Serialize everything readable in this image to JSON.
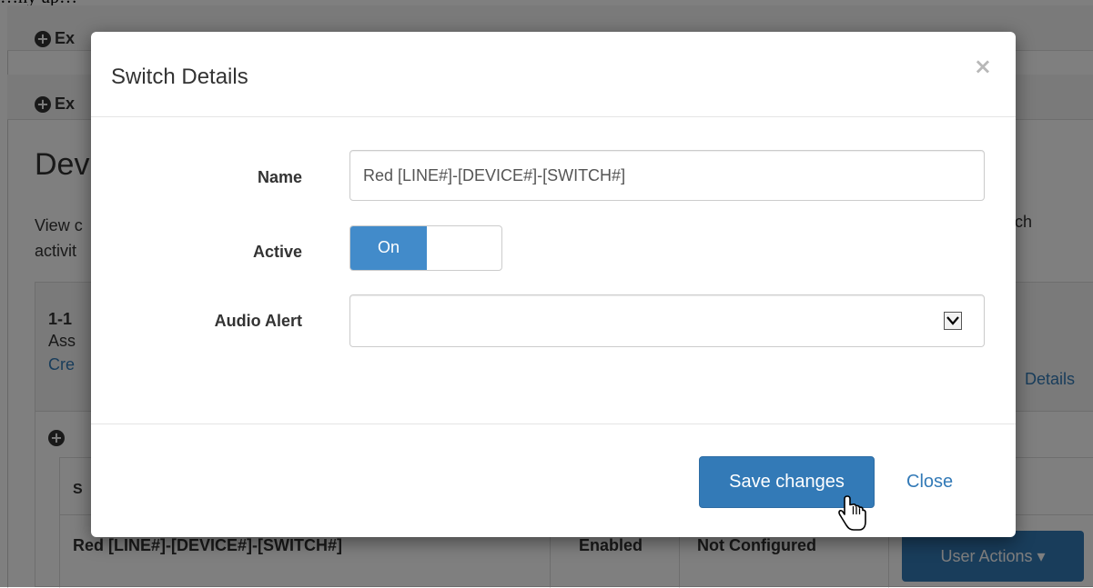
{
  "top_caption": "…hy up…",
  "background": {
    "expand_link_1": "Ex",
    "expand_link_2": "Ex",
    "title": "Dev",
    "desc_line1": "View c",
    "desc_line2": "activit",
    "desc_right": "tch",
    "card": {
      "id": "1-1",
      "subtitle": "Ass",
      "link": "Cre",
      "details_link": "Details",
      "table_header": "S",
      "row": {
        "name": "Red [LINE#]-[DEVICE#]-[SWITCH#]",
        "status": "Enabled",
        "audio": "Not Configured",
        "actions_label": "User Actions ▾"
      }
    }
  },
  "modal": {
    "title": "Switch Details",
    "close_symbol": "×",
    "fields": {
      "name_label": "Name",
      "name_value": "Red [LINE#]-[DEVICE#]-[SWITCH#]",
      "active_label": "Active",
      "active_toggle_label": "On",
      "active_state": true,
      "audio_label": "Audio Alert",
      "audio_value": ""
    },
    "footer": {
      "save_label": "Save changes",
      "close_label": "Close"
    }
  },
  "colors": {
    "primary": "#337ab7",
    "toggle_on": "#428bca",
    "backdrop": "rgba(0,0,0,0.5)"
  },
  "icons": {
    "expand": "plus-circle-icon",
    "dropdown": "chevron-down-icon",
    "cursor": "hand-pointer-icon"
  }
}
